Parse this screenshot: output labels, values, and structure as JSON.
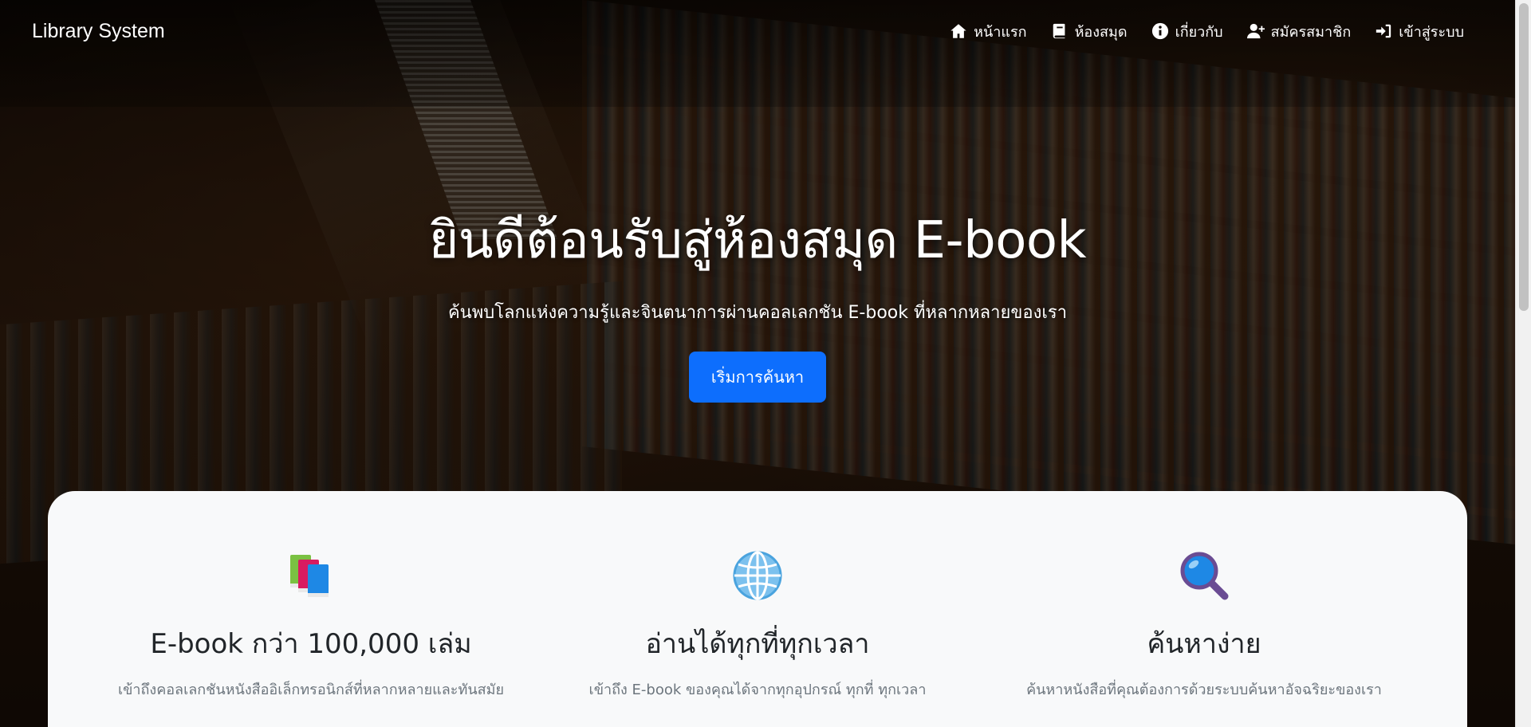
{
  "navbar": {
    "brand": "Library System",
    "links": [
      {
        "label": "หน้าแรก",
        "icon": "home-icon"
      },
      {
        "label": "ห้องสมุด",
        "icon": "book-icon"
      },
      {
        "label": "เกี่ยวกับ",
        "icon": "info-icon"
      },
      {
        "label": "สมัครสมาชิก",
        "icon": "user-plus-icon"
      },
      {
        "label": "เข้าสู่ระบบ",
        "icon": "sign-in-icon"
      }
    ]
  },
  "hero": {
    "title": "ยินดีต้อนรับสู่ห้องสมุด E-book",
    "subtitle": "ค้นพบโลกแห่งความรู้และจินตนาการผ่านคอลเลกชัน E-book ที่หลากหลายของเรา",
    "button_label": "เริ่มการค้นหา",
    "button_color": "#0d6efd"
  },
  "features": [
    {
      "icon": "books-icon",
      "title": "E-book กว่า 100,000 เล่ม",
      "desc": "เข้าถึงคอลเลกชันหนังสืออิเล็กทรอนิกส์ที่หลากหลายและทันสมัย"
    },
    {
      "icon": "globe-icon",
      "title": "อ่านได้ทุกที่ทุกเวลา",
      "desc": "เข้าถึง E-book ของคุณได้จากทุกอุปกรณ์ ทุกที่ ทุกเวลา"
    },
    {
      "icon": "magnifier-icon",
      "title": "ค้นหาง่าย",
      "desc": "ค้นหาหนังสือที่คุณต้องการด้วยระบบค้นหาอัจฉริยะของเรา"
    }
  ]
}
